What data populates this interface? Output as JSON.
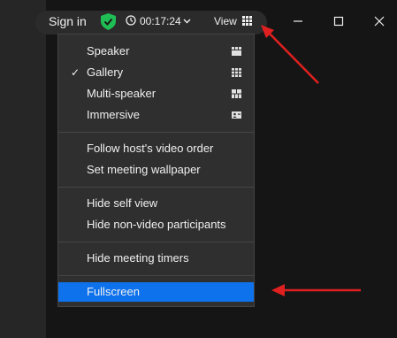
{
  "titlebar": {
    "sign_in": "Sign in",
    "timer": "00:17:24",
    "view_label": "View"
  },
  "menu": {
    "items": [
      {
        "label": "Speaker",
        "checked": false,
        "icon": "speaker-layout-icon"
      },
      {
        "label": "Gallery",
        "checked": true,
        "icon": "gallery-layout-icon"
      },
      {
        "label": "Multi-speaker",
        "checked": false,
        "icon": "multi-speaker-layout-icon"
      },
      {
        "label": "Immersive",
        "checked": false,
        "icon": "immersive-layout-icon"
      },
      {
        "label": "Follow host's video order"
      },
      {
        "label": "Set meeting wallpaper"
      },
      {
        "label": "Hide self view"
      },
      {
        "label": "Hide non-video participants"
      },
      {
        "label": "Hide meeting timers"
      },
      {
        "label": "Fullscreen",
        "highlighted": true
      }
    ],
    "check_glyph": "✓"
  },
  "colors": {
    "highlight": "#0e72ed",
    "shield": "#1fbd54",
    "annotation_arrow": "#e02020"
  }
}
